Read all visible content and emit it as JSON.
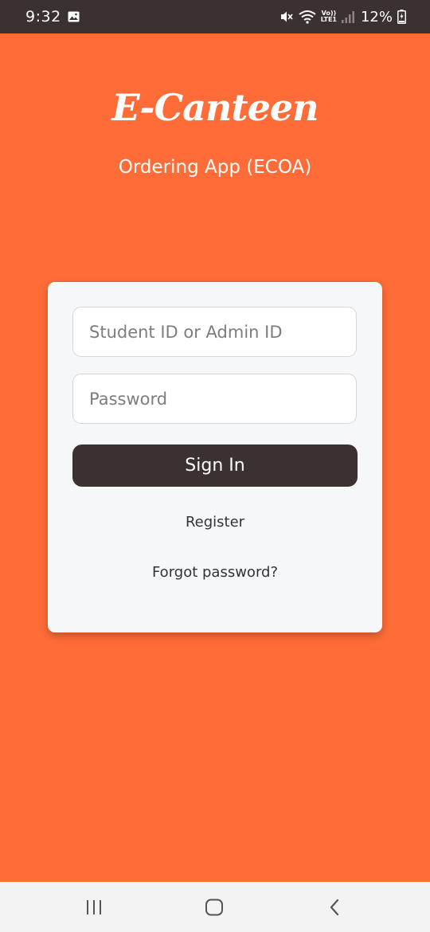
{
  "status_bar": {
    "time": "9:32",
    "battery": "12%",
    "network_top": "Vo))",
    "network_bottom": "LTE1",
    "icons": [
      "gallery-icon",
      "mute-icon",
      "wifi-icon",
      "signal-icon",
      "battery-charging-icon"
    ]
  },
  "app": {
    "logo": "E-Canteen",
    "subtitle": "Ordering App (ECOA)"
  },
  "login": {
    "id_placeholder": "Student ID or Admin ID",
    "id_value": "",
    "password_placeholder": "Password",
    "password_value": "",
    "signin_label": "Sign In",
    "register_label": "Register",
    "forgot_label": "Forgot password?"
  },
  "nav": {
    "icons": [
      "recent-apps-icon",
      "home-icon",
      "back-icon"
    ]
  },
  "colors": {
    "background": "#ff6c37",
    "dark": "#3b3131",
    "card": "#f6f7f9"
  }
}
